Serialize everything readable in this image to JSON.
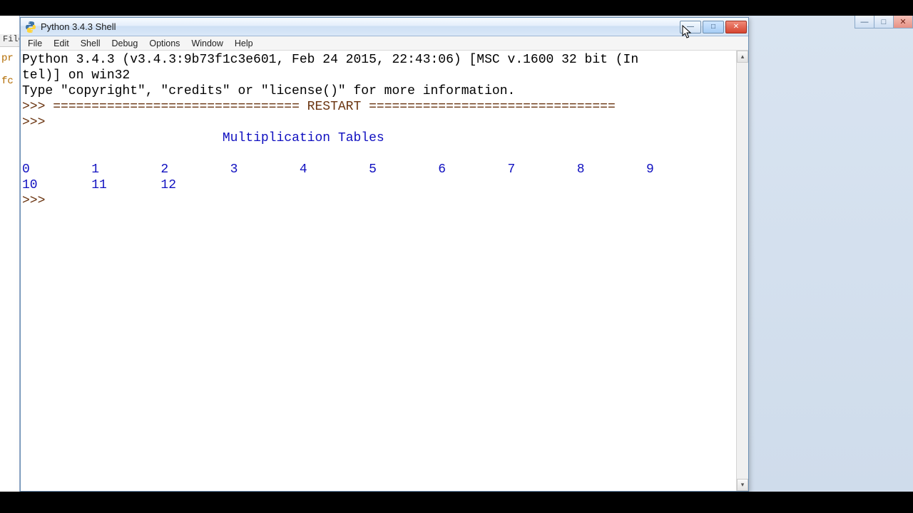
{
  "outer_window_controls": {
    "min": "—",
    "max": "□",
    "close": "✕"
  },
  "bg_window": {
    "menu_label": "File",
    "token_pr": "pr",
    "token_fc": "fc"
  },
  "idle": {
    "title": "Python 3.4.3 Shell",
    "menus": [
      "File",
      "Edit",
      "Shell",
      "Debug",
      "Options",
      "Window",
      "Help"
    ],
    "controls": {
      "min": "—",
      "max": "□",
      "close": "✕"
    },
    "content": {
      "banner_line1": "Python 3.4.3 (v3.4.3:9b73f1c3e601, Feb 24 2015, 22:43:06) [MSC v.1600 32 bit (In",
      "banner_line2": "tel)] on win32",
      "banner_line3": "Type \"copyright\", \"credits\" or \"license()\" for more information.",
      "prompt": ">>> ",
      "restart_line": "================================ RESTART ================================",
      "heading_indent": "                          ",
      "heading": "Multiplication Tables",
      "numbers_row1": "0        1        2        3        4        5        6        7        8        9        ",
      "numbers_row2": "10       11       12       "
    },
    "scrollbar": {
      "up": "▴",
      "down": "▾"
    }
  }
}
